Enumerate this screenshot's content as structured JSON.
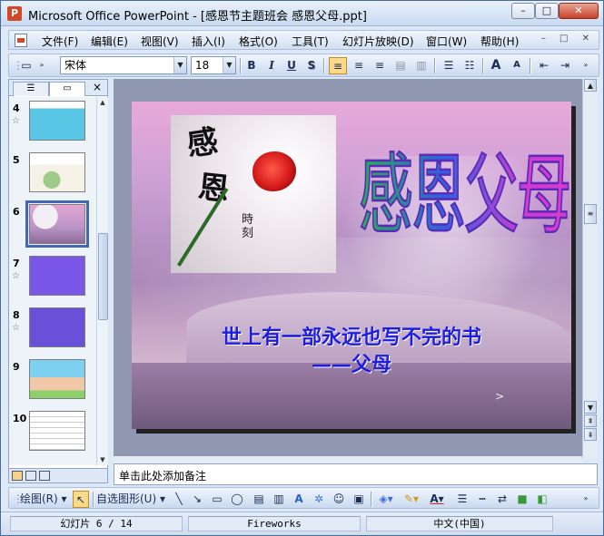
{
  "window": {
    "title": "Microsoft Office PowerPoint - [感恩节主题班会 感恩父母.ppt]",
    "app_icon": "powerpoint-icon",
    "min": "–",
    "max": "□",
    "close": "✕"
  },
  "menu": {
    "items": [
      "文件(F)",
      "编辑(E)",
      "视图(V)",
      "插入(I)",
      "格式(O)",
      "工具(T)",
      "幻灯片放映(D)",
      "窗口(W)",
      "帮助(H)"
    ],
    "mdi": "– □ ✕"
  },
  "toolbar": {
    "font_name": "宋体",
    "font_size": "18",
    "bold": "B",
    "italic": "I",
    "underline": "U",
    "shadow": "S",
    "grow": "A",
    "shrink": "A"
  },
  "slides_pane": {
    "close": "×",
    "slides": [
      {
        "num": "4",
        "star": "☆"
      },
      {
        "num": "5",
        "star": ""
      },
      {
        "num": "6",
        "star": ""
      },
      {
        "num": "7",
        "star": "☆"
      },
      {
        "num": "8",
        "star": "☆"
      },
      {
        "num": "9",
        "star": ""
      },
      {
        "num": "10",
        "star": ""
      }
    ],
    "selected": "6"
  },
  "slide": {
    "wordart": "感恩父母",
    "calligraphy_top": "感",
    "calligraphy_mid": "恩",
    "calligraphy_small": "時刻",
    "subtitle_line1": "世上有一部永远也写不完的书",
    "subtitle_line2": "——父母",
    "nav": ">"
  },
  "notes": {
    "placeholder": "单击此处添加备注"
  },
  "drawbar": {
    "draw_label": "绘图(R)",
    "autoshapes_label": "自选图形(U)"
  },
  "status": {
    "slide": "幻灯片 6 / 14",
    "design": "Fireworks",
    "language": "中文(中国)"
  },
  "colors": {
    "window_frame": "#4a6b9a",
    "office_blue": "#dfe8f6",
    "subtitle": "#1d1de0",
    "selection": "#4466b5"
  }
}
